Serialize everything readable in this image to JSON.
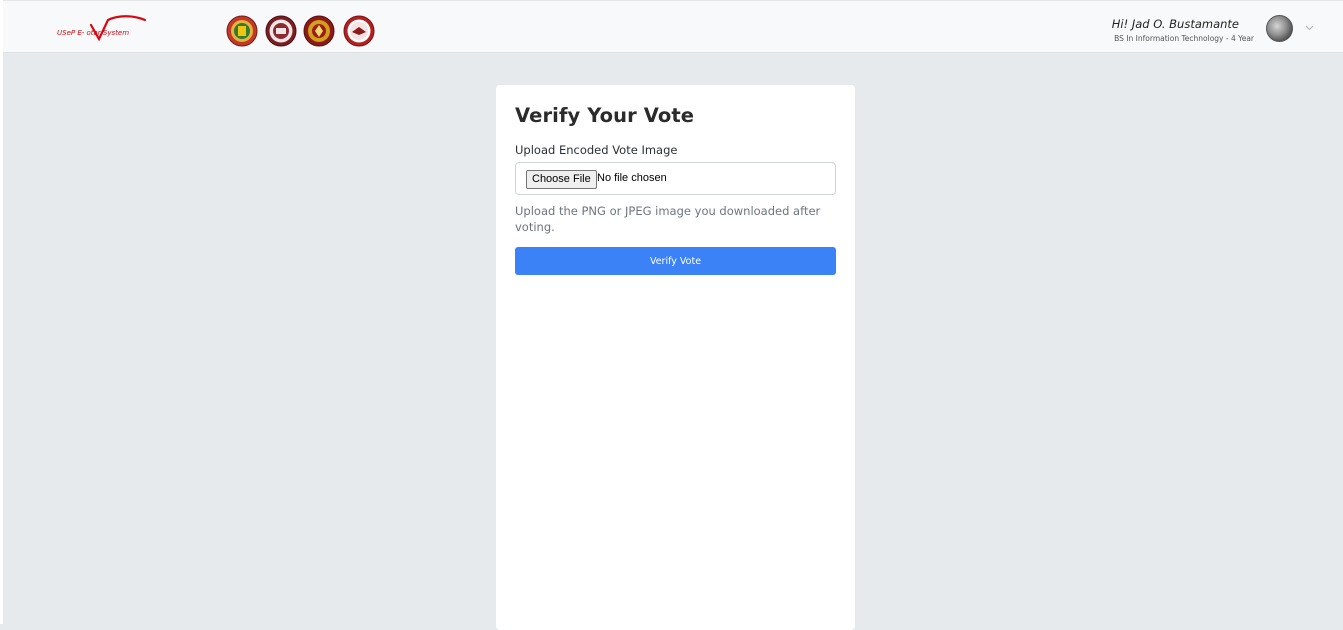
{
  "header": {
    "logo_text": "USeP E-   otar System",
    "logo_color": "#d40a12",
    "seals": [
      {
        "name": "seal-1",
        "ring": "#c0392b",
        "inner": "#2e7d32"
      },
      {
        "name": "seal-2",
        "ring": "#7b1e24",
        "inner": "#f2e6e6"
      },
      {
        "name": "seal-3",
        "ring": "#8b1a1a",
        "inner": "#d4a017"
      },
      {
        "name": "seal-4",
        "ring": "#b22222",
        "inner": "#ffffff"
      }
    ],
    "user": {
      "greeting": "Hi! Jad O. Bustamante",
      "program": "BS In Information Technology - 4 Year"
    }
  },
  "card": {
    "title": "Verify Your Vote",
    "upload_label": "Upload Encoded Vote Image",
    "choose_file_label": "Choose File",
    "file_status": "No file chosen",
    "help_text": "Upload the PNG or JPEG image you downloaded after voting.",
    "verify_button": "Verify Vote"
  },
  "colors": {
    "accent": "#3b82f6",
    "page_bg": "#e7eaed"
  }
}
